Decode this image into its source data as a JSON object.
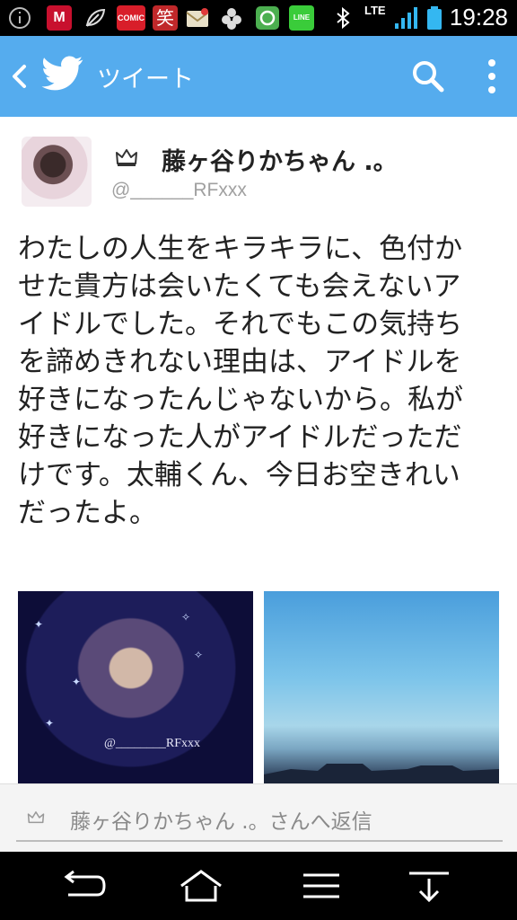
{
  "status_bar": {
    "network": "LTE",
    "time": "19:28",
    "icons": [
      "info-icon",
      "mcafee-icon",
      "leaf-icon",
      "comic-app-icon",
      "warai-app-icon",
      "mail-app-icon",
      "puzzle-icon",
      "green-app-icon",
      "line-app-icon",
      "bluetooth-icon",
      "signal-icon",
      "battery-icon"
    ],
    "comic_label": "COMIC",
    "warai_label": "笑",
    "line_label": "LINE",
    "mcafee_label": "M"
  },
  "app_bar": {
    "title": "ツイート",
    "accent": "#55acee"
  },
  "tweet": {
    "display_name": "藤ヶ谷りかちゃん .。",
    "handle": "@______RFxxx",
    "text": "わたしの人生をキラキラに、色付か\nせた貴方は会いたくても会えないア\nイドルでした。それでもこの気持ち\nを諦めきれない理由は、アイドルを\n好きになったんじゃないから。私が\n好きになった人がアイドルだっただ\nけです。太輔くん、今日お空きれい\nだったよ。",
    "photos": [
      {
        "watermark": "@________RFxxx"
      },
      {
        "watermark": ""
      }
    ]
  },
  "reply": {
    "placeholder": "藤ヶ谷りかちゃん .。さんへ返信"
  },
  "nav_bar": {
    "buttons": [
      "back-icon",
      "home-icon",
      "menu-icon",
      "download-icon"
    ]
  }
}
